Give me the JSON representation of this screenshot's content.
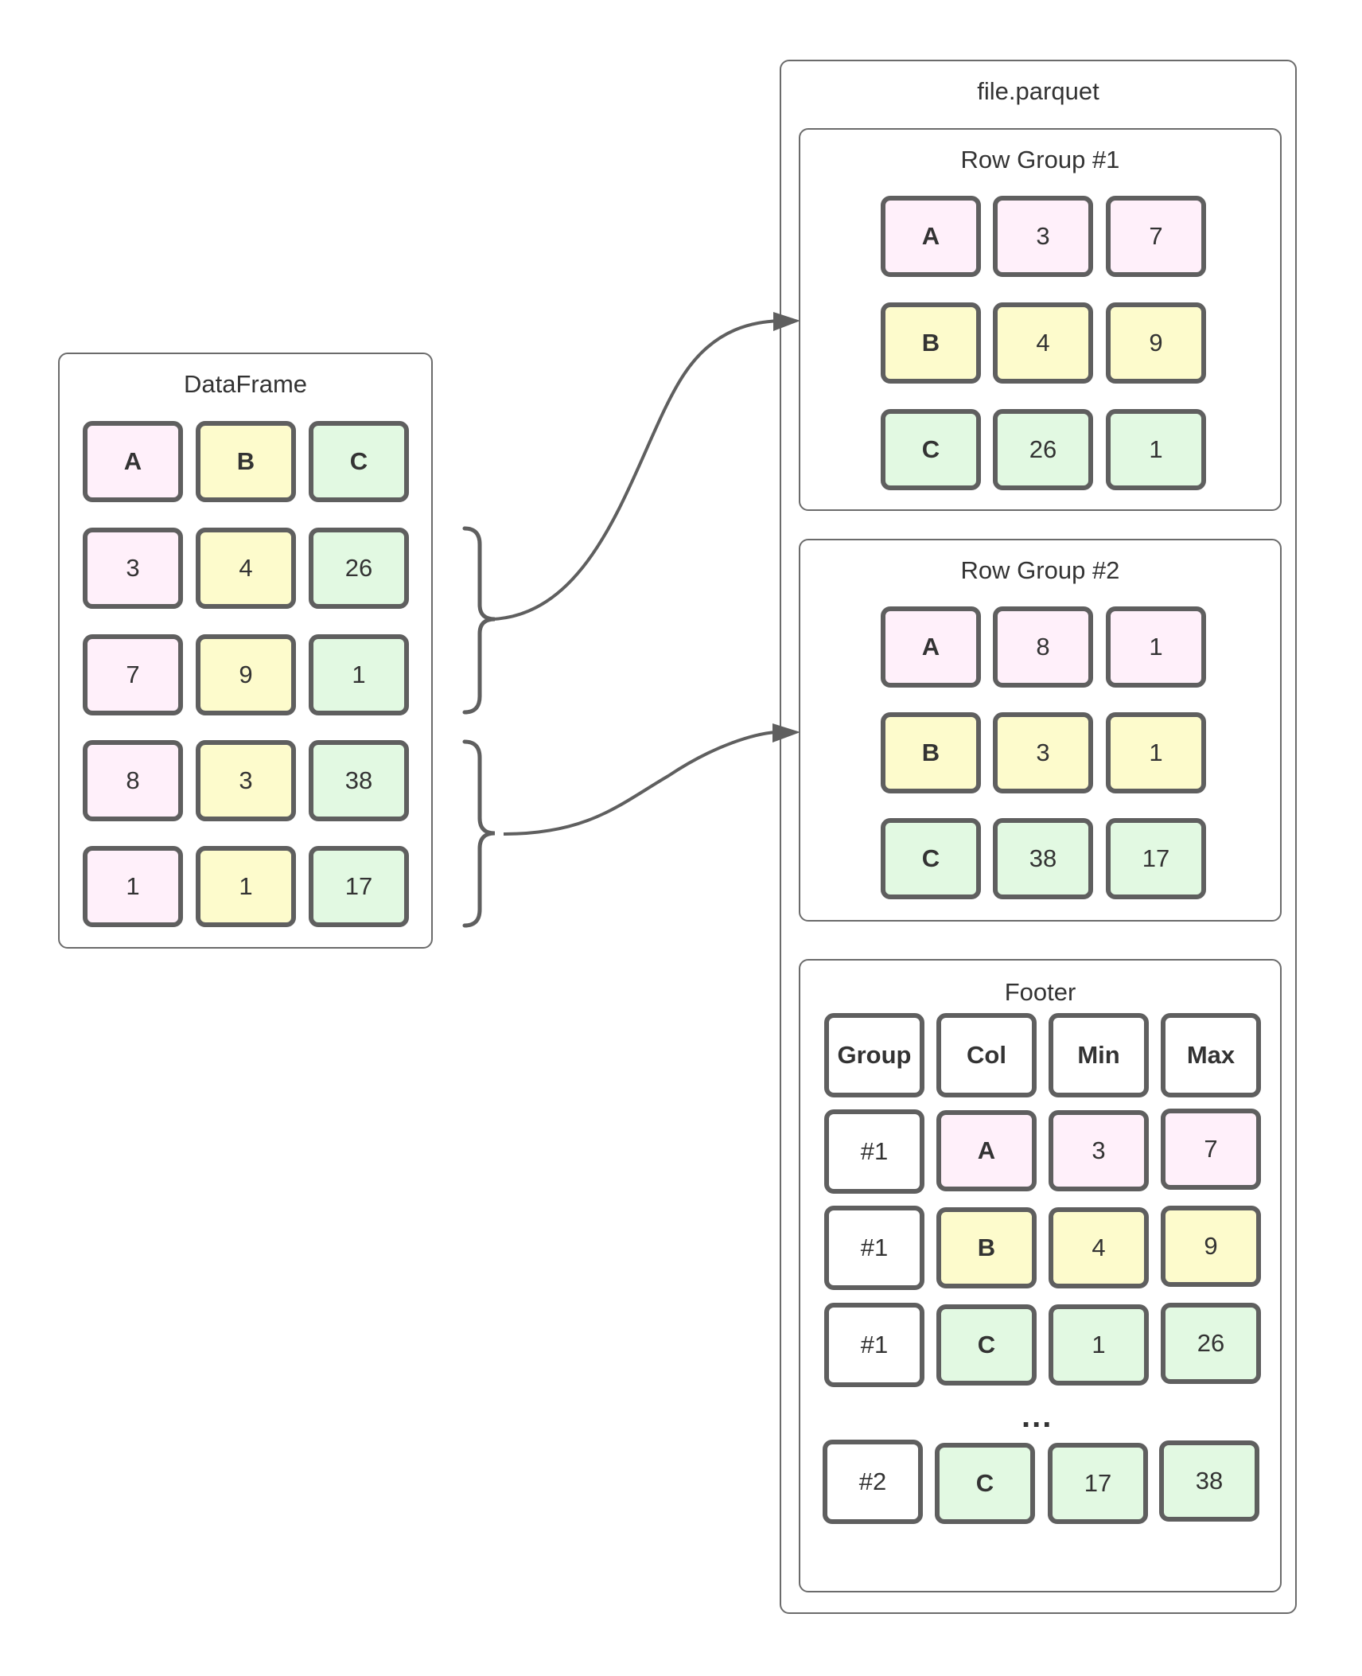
{
  "dataframe": {
    "title": "DataFrame",
    "columns": [
      "A",
      "B",
      "C"
    ],
    "rows": [
      [
        "3",
        "4",
        "26"
      ],
      [
        "7",
        "9",
        "1"
      ],
      [
        "8",
        "3",
        "38"
      ],
      [
        "1",
        "1",
        "17"
      ]
    ]
  },
  "file": {
    "title": "file.parquet",
    "row_groups": [
      {
        "title": "Row Group #1",
        "rows": [
          [
            "A",
            "3",
            "7"
          ],
          [
            "B",
            "4",
            "9"
          ],
          [
            "C",
            "26",
            "1"
          ]
        ]
      },
      {
        "title": "Row Group #2",
        "rows": [
          [
            "A",
            "8",
            "1"
          ],
          [
            "B",
            "3",
            "1"
          ],
          [
            "C",
            "38",
            "17"
          ]
        ]
      }
    ],
    "footer": {
      "title": "Footer",
      "headers": [
        "Group",
        "Col",
        "Min",
        "Max"
      ],
      "rows": [
        [
          "#1",
          "A",
          "3",
          "7"
        ],
        [
          "#1",
          "B",
          "4",
          "9"
        ],
        [
          "#1",
          "C",
          "1",
          "26"
        ]
      ],
      "ellipsis": "...",
      "last_row": [
        "#2",
        "C",
        "17",
        "38"
      ]
    }
  },
  "colors": {
    "A": "#fff0fa",
    "B": "#fdfbcc",
    "C": "#e2f9e2",
    "stroke": "#5f5f5f"
  },
  "connectors": [
    {
      "from": "dataframe-rows-1-2",
      "to": "row-group-1"
    },
    {
      "from": "dataframe-rows-3-4",
      "to": "row-group-2"
    }
  ]
}
